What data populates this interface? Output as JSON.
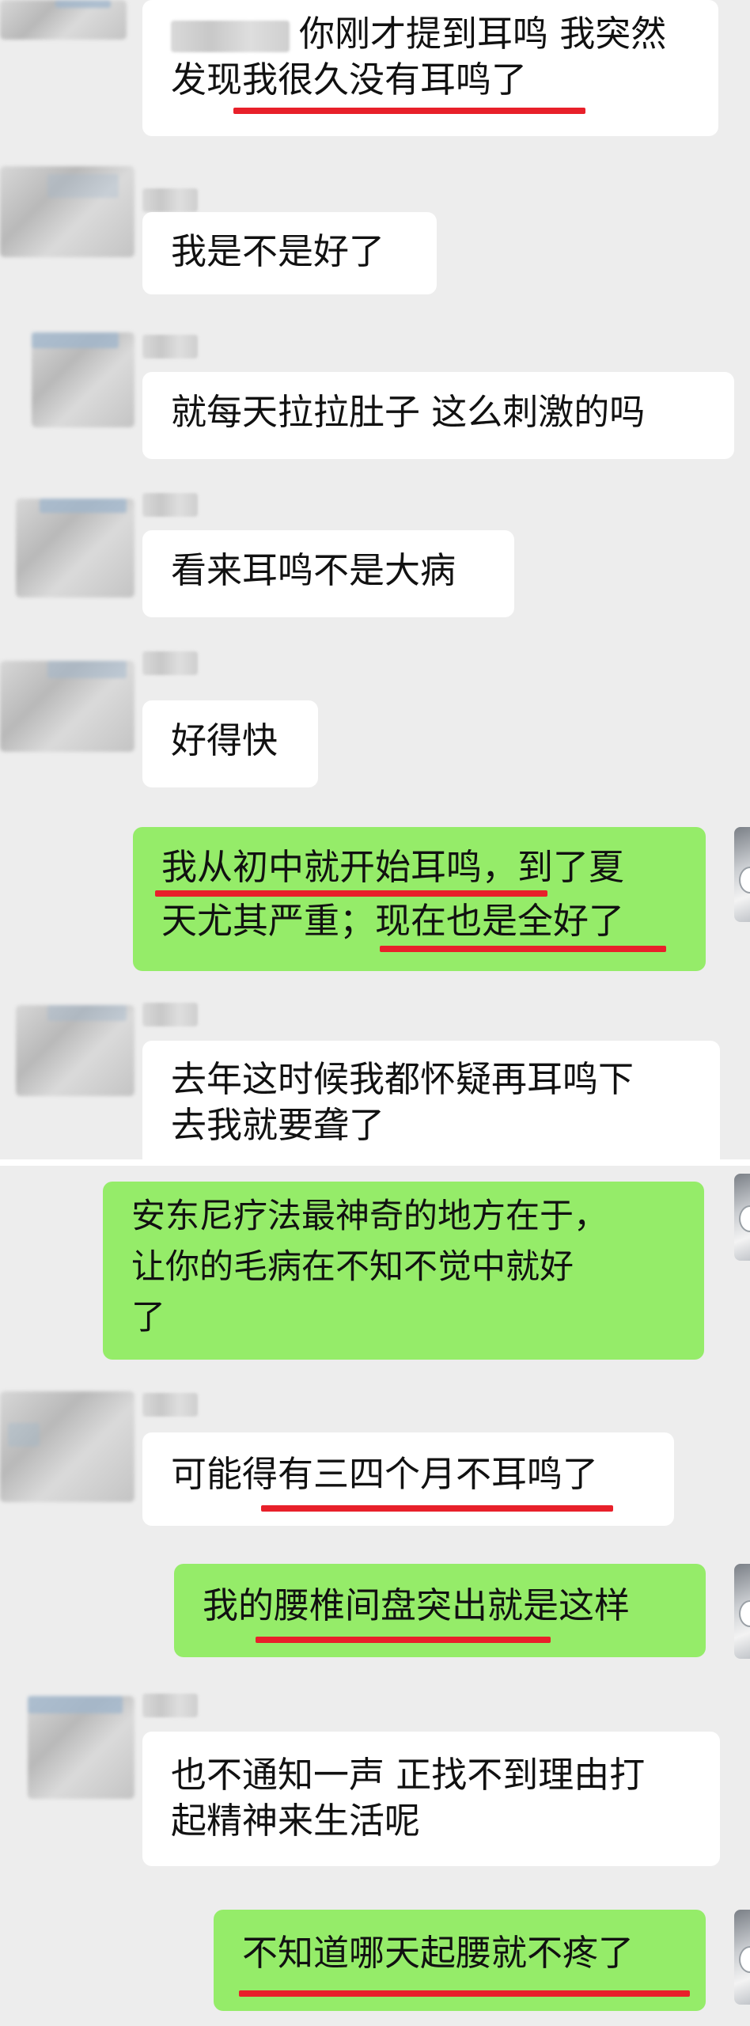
{
  "messages": [
    {
      "side": "in",
      "lines": [
        "你刚才提到耳鸣 我突然",
        "发现我很久没有耳鸣了"
      ]
    },
    {
      "side": "in",
      "lines": [
        "我是不是好了"
      ]
    },
    {
      "side": "in",
      "lines": [
        "就每天拉拉肚子  这么刺激的吗"
      ]
    },
    {
      "side": "in",
      "lines": [
        "看来耳鸣不是大病"
      ]
    },
    {
      "side": "in",
      "lines": [
        "好得快"
      ]
    },
    {
      "side": "out",
      "lines": [
        "我从初中就开始耳鸣，到了夏",
        "天尤其严重；现在也是全好了"
      ]
    },
    {
      "side": "in",
      "lines": [
        "去年这时候我都怀疑再耳鸣下",
        "去我就要聋了"
      ]
    },
    {
      "side": "out",
      "lines": [
        "安东尼疗法最神奇的地方在于，",
        "让你的毛病在不知不觉中就好",
        "了"
      ]
    },
    {
      "side": "in",
      "lines": [
        "可能得有三四个月不耳鸣了"
      ]
    },
    {
      "side": "out",
      "lines": [
        "我的腰椎间盘突出就是这样"
      ]
    },
    {
      "side": "in",
      "lines": [
        "也不通知一声 正找不到理由打",
        "起精神来生活呢"
      ]
    },
    {
      "side": "out",
      "lines": [
        "不知道哪天起腰就不疼了"
      ]
    }
  ],
  "colors": {
    "background": "#ededed",
    "incoming_bubble": "#ffffff",
    "outgoing_bubble": "#95ec69",
    "underline": "#e8202a"
  }
}
